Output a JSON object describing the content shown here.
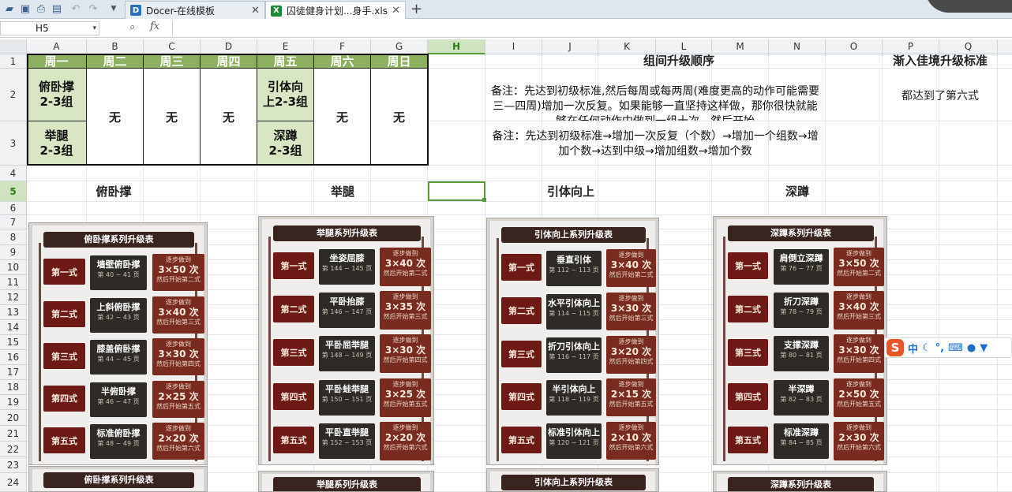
{
  "tabs": [
    {
      "label": "Docer-在线模板",
      "icon": "docer-icon"
    },
    {
      "label": "囚徒健身计划...身手.xls",
      "icon": "excel-file-icon"
    }
  ],
  "namebox": "H5",
  "fx_label": "fx",
  "columns": [
    "A",
    "B",
    "C",
    "D",
    "E",
    "F",
    "G",
    "H",
    "I",
    "J",
    "K",
    "L",
    "M",
    "N",
    "O",
    "P",
    "Q"
  ],
  "rows": [
    "1",
    "2",
    "3",
    "4",
    "5",
    "6",
    "7",
    "8",
    "9",
    "10",
    "11",
    "12",
    "13",
    "14",
    "15",
    "16",
    "17",
    "18",
    "19",
    "20",
    "21",
    "22",
    "23",
    "24"
  ],
  "schedule": {
    "days": [
      "周一",
      "周二",
      "周三",
      "周四",
      "周五",
      "周六",
      "周日"
    ],
    "mon_1": "俯卧撑\n2-3组",
    "mon_2": "举腿\n2-3组",
    "tue": "无",
    "wed": "无",
    "thu": "无",
    "fri_1": "引体向\n上2-3组",
    "fri_2": "深蹲\n2-3组",
    "sat": "无",
    "sun": "无"
  },
  "group_order": {
    "title": "组间升级顺序",
    "note1": "备注：先达到初级标准,然后每周或每两周(难度更高的动作可能需要三—四周)增加一次反复。如果能够一直坚持这样做，那你很快就能够在任何动作中做到一组十次，然后开始",
    "note2": "备注：先达到初级标准→增加一次反复（个数）→增加一个组数→增加个数→达到中级→增加组数→增加个数"
  },
  "mastery": {
    "title": "渐入佳境升级标准",
    "text": "都达到了第六式"
  },
  "section_titles": {
    "pushup": "俯卧撑",
    "legraise": "举腿",
    "pullup": "引体向上",
    "squat": "深蹲"
  },
  "cards": [
    {
      "title": "俯卧撑系列升级表",
      "bottom_title": "俯卧撑系列升级表",
      "levels": [
        {
          "level": "第一式",
          "move": "墙壁俯卧撑",
          "pages": "第 40 ~ 41 页",
          "pre": "逐步做到",
          "target": "3×50 次",
          "post": "然后开始第二式"
        },
        {
          "level": "第二式",
          "move": "上斜俯卧撑",
          "pages": "第 42 ~ 43 页",
          "pre": "逐步做到",
          "target": "3×40 次",
          "post": "然后开始第三式"
        },
        {
          "level": "第三式",
          "move": "膝盖俯卧撑",
          "pages": "第 44 ~ 45 页",
          "pre": "逐步做到",
          "target": "3×30 次",
          "post": "然后开始第四式"
        },
        {
          "level": "第四式",
          "move": "半俯卧撑",
          "pages": "第 46 ~ 47 页",
          "pre": "逐步做到",
          "target": "2×25 次",
          "post": "然后开始第五式"
        },
        {
          "level": "第五式",
          "move": "标准俯卧撑",
          "pages": "第 48 ~ 49 页",
          "pre": "逐步做到",
          "target": "2×20 次",
          "post": "然后开始第六式"
        }
      ]
    },
    {
      "title": "举腿系列升级表",
      "bottom_title": "举腿系列升级表",
      "levels": [
        {
          "level": "第一式",
          "move": "坐姿屈膝",
          "pages": "第 144 ~ 145 页",
          "pre": "逐步做到",
          "target": "3×40 次",
          "post": "然后开始第二式"
        },
        {
          "level": "第二式",
          "move": "平卧抬膝",
          "pages": "第 146 ~ 147 页",
          "pre": "逐步做到",
          "target": "3×35 次",
          "post": "然后开始第三式"
        },
        {
          "level": "第三式",
          "move": "平卧屈举腿",
          "pages": "第 148 ~ 149 页",
          "pre": "逐步做到",
          "target": "3×30 次",
          "post": "然后开始第四式"
        },
        {
          "level": "第四式",
          "move": "平卧蛙举腿",
          "pages": "第 150 ~ 151 页",
          "pre": "逐步做到",
          "target": "3×25 次",
          "post": "然后开始第五式"
        },
        {
          "level": "第五式",
          "move": "平卧直举腿",
          "pages": "第 152 ~ 153 页",
          "pre": "逐步做到",
          "target": "2×20 次",
          "post": "然后开始第六式"
        }
      ]
    },
    {
      "title": "引体向上系列升级表",
      "bottom_title": "引体向上系列升级表",
      "levels": [
        {
          "level": "第一式",
          "move": "垂直引体",
          "pages": "第 112 ~ 113 页",
          "pre": "逐步做到",
          "target": "3×40 次",
          "post": "然后开始第二式"
        },
        {
          "level": "第二式",
          "move": "水平引体向上",
          "pages": "第 114 ~ 115 页",
          "pre": "逐步做到",
          "target": "3×30 次",
          "post": "然后开始第三式"
        },
        {
          "level": "第三式",
          "move": "折刀引体向上",
          "pages": "第 116 ~ 117 页",
          "pre": "逐步做到",
          "target": "3×20 次",
          "post": "然后开始第四式"
        },
        {
          "level": "第四式",
          "move": "半引体向上",
          "pages": "第 118 ~ 119 页",
          "pre": "逐步做到",
          "target": "2×15 次",
          "post": "然后开始第五式"
        },
        {
          "level": "第五式",
          "move": "标准引体向上",
          "pages": "第 120 ~ 121 页",
          "pre": "逐步做到",
          "target": "2×10 次",
          "post": "然后开始第六式"
        }
      ]
    },
    {
      "title": "深蹲系列升级表",
      "bottom_title": "深蹲系列升级表",
      "levels": [
        {
          "level": "第一式",
          "move": "肩倒立深蹲",
          "pages": "第 76 ~ 77 页",
          "pre": "逐步做到",
          "target": "3×50 次",
          "post": "然后开始第二式"
        },
        {
          "level": "第二式",
          "move": "折刀深蹲",
          "pages": "第 78 ~ 79 页",
          "pre": "逐步做到",
          "target": "3×40 次",
          "post": "然后开始第三式"
        },
        {
          "level": "第三式",
          "move": "支撑深蹲",
          "pages": "第 80 ~ 81 页",
          "pre": "逐步做到",
          "target": "3×30 次",
          "post": "然后开始第四式"
        },
        {
          "level": "第四式",
          "move": "半深蹲",
          "pages": "第 82 ~ 83 页",
          "pre": "逐步做到",
          "target": "2×50 次",
          "post": "然后开始第五式"
        },
        {
          "level": "第五式",
          "move": "标准深蹲",
          "pages": "第 84 ~ 85 页",
          "pre": "逐步做到",
          "target": "2×30 次",
          "post": "然后开始第六式"
        }
      ]
    }
  ],
  "ime": {
    "logo": "S",
    "lang": "中"
  },
  "colors": {
    "header_green": "#8db060",
    "exercise_fill": "#d8e6c4",
    "selection": "#5a9a3a",
    "card_red": "#6d1a16"
  }
}
